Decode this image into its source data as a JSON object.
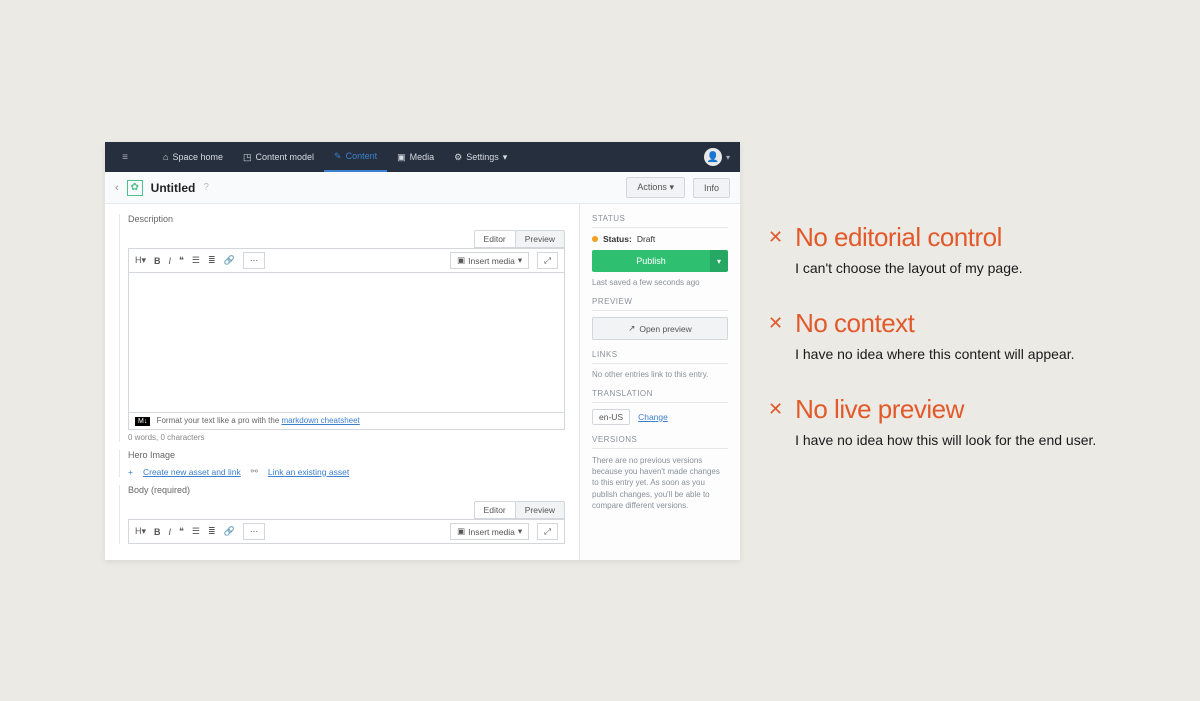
{
  "nav": {
    "items": [
      "Space home",
      "Content model",
      "Content",
      "Media",
      "Settings"
    ],
    "activeIndex": 2,
    "settingsHasChevron": true
  },
  "titlebar": {
    "title": "Untitled",
    "actions_label": "Actions",
    "info_label": "Info"
  },
  "fields": {
    "description_label": "Description",
    "tab_editor": "Editor",
    "tab_preview": "Preview",
    "insert_media_label": "Insert media",
    "md_hint_prefix": "Format your text like a pro with the ",
    "md_hint_link": "markdown cheatsheet",
    "counter": "0 words, 0 characters",
    "hero_label": "Hero Image",
    "hero_new_link": "Create new asset and link",
    "hero_existing_link": "Link an existing asset",
    "body_label": "Body (required)"
  },
  "side": {
    "status_title": "STATUS",
    "status_label": "Status:",
    "status_value": "Draft",
    "publish_label": "Publish",
    "last_saved": "Last saved a few seconds ago",
    "preview_title": "PREVIEW",
    "open_preview": "Open preview",
    "links_title": "LINKS",
    "links_empty": "No other entries link to this entry.",
    "translation_title": "TRANSLATION",
    "locale": "en-US",
    "change_label": "Change",
    "versions_title": "VERSIONS",
    "versions_text": "There are no previous versions because you haven't made changes to this entry yet. As soon as you publish changes, you'll be able to compare different versions."
  },
  "annotations": [
    {
      "title": "No editorial control",
      "desc": "I can't choose the layout of my page."
    },
    {
      "title": "No context",
      "desc": "I have no idea where this content will appear."
    },
    {
      "title": "No live preview",
      "desc": "I have no idea how this will look for the end user."
    }
  ]
}
